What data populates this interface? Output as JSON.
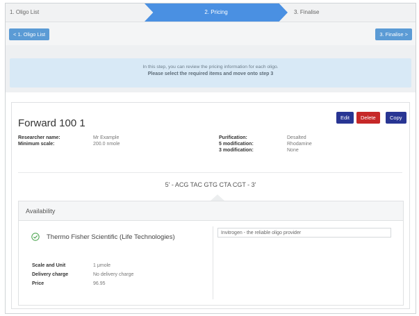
{
  "stepper": {
    "steps": [
      "1. Oligo List",
      "2. Pricing",
      "3. Finalise"
    ]
  },
  "nav": {
    "prev_label": "< 1. Oligo List",
    "next_label": "3. Finalise >"
  },
  "info": {
    "line1": "In this step, you can review the pricing information for each oligo.",
    "line2": "Please select the required items and move onto step 3"
  },
  "oligo": {
    "title": "Forward 100 1",
    "actions": {
      "edit": "Edit",
      "delete": "Delete",
      "copy": "Copy"
    },
    "left_fields": [
      {
        "label": "Researcher name:",
        "value": "Mr Example"
      },
      {
        "label": "Minimum scale:",
        "value": "200.0 nmole"
      }
    ],
    "right_fields": [
      {
        "label": "Purification:",
        "value": "Desalted"
      },
      {
        "label": "5 modification:",
        "value": "Rhodamine"
      },
      {
        "label": "3 modification:",
        "value": "None"
      }
    ],
    "sequence": "5' - ACG TAC GTG CTA CGT - 3'"
  },
  "availability": {
    "title": "Availability",
    "supplier": "Thermo Fisher Scientific (Life Technologies)",
    "description_value": "Invitrogen - the reliable oligo provider",
    "details": [
      {
        "label": "Scale and Unit",
        "value": "1 μmole"
      },
      {
        "label": "Delivery charge",
        "value": "No delivery charge"
      },
      {
        "label": "Price",
        "value": "96.95"
      }
    ]
  },
  "colors": {
    "active_step": "#4a90e2",
    "nav_button": "#5b9bd5",
    "edit_copy": "#283593",
    "delete": "#c62828",
    "success": "#43a047"
  },
  "icons": {
    "supplier_status": "check-circle-icon"
  }
}
